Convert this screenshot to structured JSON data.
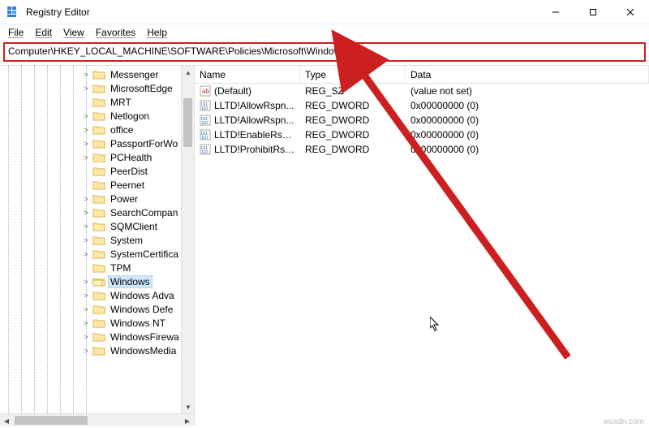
{
  "window": {
    "title": "Registry Editor"
  },
  "menu": {
    "items": [
      "File",
      "Edit",
      "View",
      "Favorites",
      "Help"
    ]
  },
  "address": {
    "path": "Computer\\HKEY_LOCAL_MACHINE\\SOFTWARE\\Policies\\Microsoft\\Windows"
  },
  "tree": {
    "indent_base": 100,
    "items": [
      {
        "label": "Messenger",
        "toggle": ">",
        "selected": false
      },
      {
        "label": "MicrosoftEdge",
        "toggle": ">",
        "selected": false
      },
      {
        "label": "MRT",
        "toggle": "",
        "selected": false
      },
      {
        "label": "Netlogon",
        "toggle": ">",
        "selected": false
      },
      {
        "label": "office",
        "toggle": ">",
        "selected": false
      },
      {
        "label": "PassportForWo",
        "toggle": ">",
        "selected": false
      },
      {
        "label": "PCHealth",
        "toggle": ">",
        "selected": false
      },
      {
        "label": "PeerDist",
        "toggle": "",
        "selected": false
      },
      {
        "label": "Peernet",
        "toggle": "",
        "selected": false
      },
      {
        "label": "Power",
        "toggle": ">",
        "selected": false
      },
      {
        "label": "SearchCompan",
        "toggle": ">",
        "selected": false
      },
      {
        "label": "SQMClient",
        "toggle": ">",
        "selected": false
      },
      {
        "label": "System",
        "toggle": ">",
        "selected": false
      },
      {
        "label": "SystemCertifica",
        "toggle": ">",
        "selected": false
      },
      {
        "label": "TPM",
        "toggle": "",
        "selected": false
      },
      {
        "label": "Windows",
        "toggle": ">",
        "selected": true
      },
      {
        "label": "Windows Adva",
        "toggle": ">",
        "selected": false
      },
      {
        "label": "Windows Defe",
        "toggle": ">",
        "selected": false
      },
      {
        "label": "Windows NT",
        "toggle": ">",
        "selected": false
      },
      {
        "label": "WindowsFirewa",
        "toggle": ">",
        "selected": false
      },
      {
        "label": "WindowsMedia",
        "toggle": ">",
        "selected": false
      }
    ]
  },
  "list": {
    "columns": {
      "name": "Name",
      "type": "Type",
      "data": "Data"
    },
    "rows": [
      {
        "kind": "sz",
        "name": "(Default)",
        "type": "REG_SZ",
        "data": "(value not set)"
      },
      {
        "kind": "dword",
        "name": "LLTD!AllowRspn...",
        "type": "REG_DWORD",
        "data": "0x00000000 (0)"
      },
      {
        "kind": "dword",
        "name": "LLTD!AllowRspn...",
        "type": "REG_DWORD",
        "data": "0x00000000 (0)"
      },
      {
        "kind": "dword",
        "name": "LLTD!EnableRspn...",
        "type": "REG_DWORD",
        "data": "0x00000000 (0)"
      },
      {
        "kind": "dword",
        "name": "LLTD!ProhibitRsp...",
        "type": "REG_DWORD",
        "data": "0x00000000 (0)"
      }
    ]
  },
  "watermark": "wsxdn.com"
}
